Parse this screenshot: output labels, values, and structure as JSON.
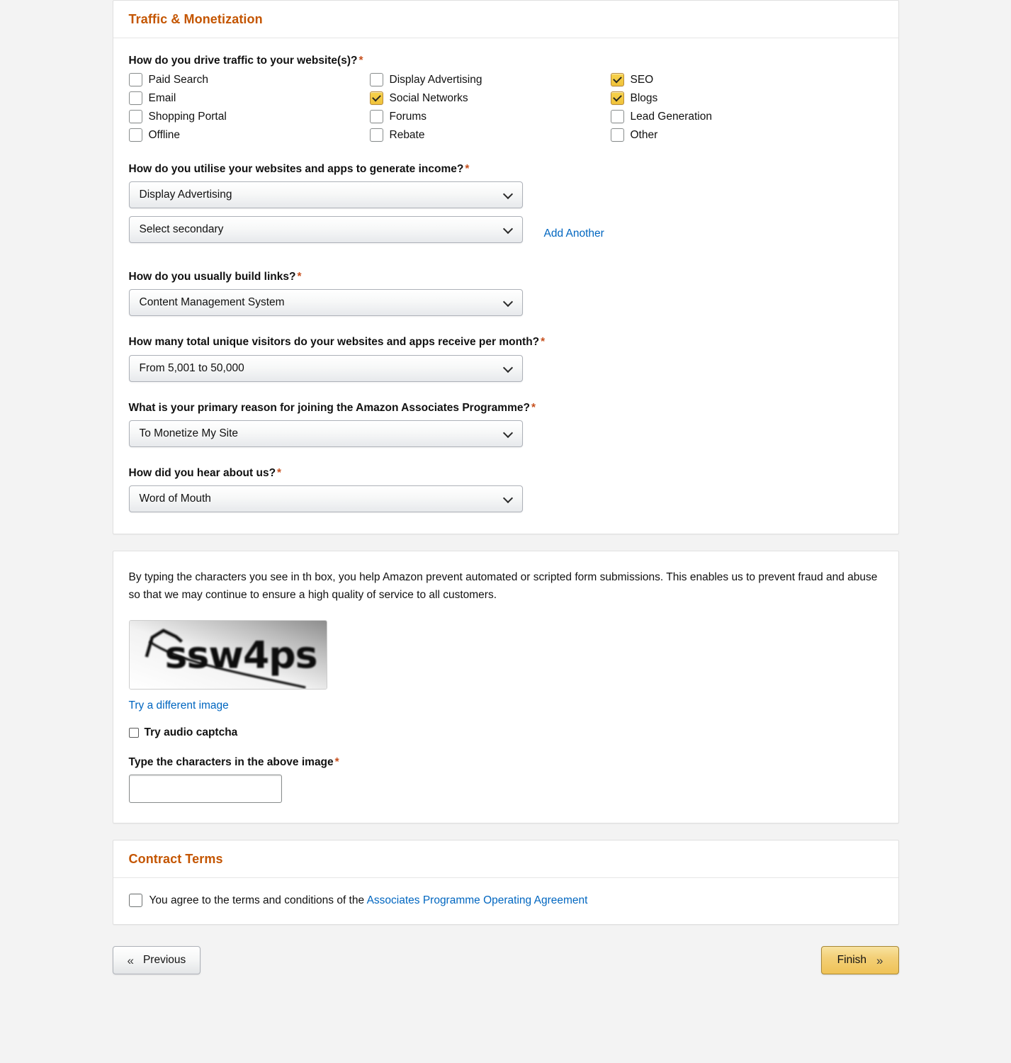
{
  "traffic_panel": {
    "title": "Traffic & Monetization",
    "traffic_question": {
      "label": "How do you drive traffic to your website(s)?",
      "required": "*",
      "options": [
        {
          "label": "Paid Search",
          "checked": false
        },
        {
          "label": "Email",
          "checked": false
        },
        {
          "label": "Shopping Portal",
          "checked": false
        },
        {
          "label": "Offline",
          "checked": false
        },
        {
          "label": "Display Advertising",
          "checked": false
        },
        {
          "label": "Social Networks",
          "checked": true
        },
        {
          "label": "Forums",
          "checked": false
        },
        {
          "label": "Rebate",
          "checked": false
        },
        {
          "label": "SEO",
          "checked": true
        },
        {
          "label": "Blogs",
          "checked": true
        },
        {
          "label": "Lead Generation",
          "checked": false
        },
        {
          "label": "Other",
          "checked": false
        }
      ]
    },
    "income_question": {
      "label": "How do you utilise your websites and apps to generate income?",
      "required": "*",
      "primary_value": "Display Advertising",
      "secondary_value": "Select secondary",
      "add_another_label": "Add Another"
    },
    "links_question": {
      "label": "How do you usually build links?",
      "required": "*",
      "value": "Content Management System"
    },
    "visitors_question": {
      "label": "How many total unique visitors do your websites and apps receive per month?",
      "required": "*",
      "value": "From 5,001 to 50,000"
    },
    "reason_question": {
      "label": "What is your primary reason for joining the Amazon Associates Programme?",
      "required": "*",
      "value": "To Monetize My Site"
    },
    "hear_question": {
      "label": "How did you hear about us?",
      "required": "*",
      "value": "Word of Mouth"
    }
  },
  "captcha_panel": {
    "intro_text": "By typing the characters you see in th box, you help Amazon prevent automated or scripted form submissions. This enables us to prevent fraud and abuse so that we may continue to ensure a high quality of service to all customers.",
    "captcha_characters": "ssw4ps",
    "try_different_image_label": "Try a different image",
    "audio_captcha_label": "Try audio captcha",
    "audio_captcha_checked": false,
    "type_characters_label": "Type the characters in the above image",
    "type_characters_required": "*",
    "captcha_input_value": "",
    "captcha_input_placeholder": ""
  },
  "contract_panel": {
    "title": "Contract Terms",
    "agree_prefix": "You agree to the terms and conditions of the ",
    "agreement_link_label": "Associates Programme Operating Agreement",
    "agree_checked": false
  },
  "footer": {
    "previous_label": "Previous",
    "previous_icon": "chevron-double-left-icon",
    "finish_label": "Finish",
    "finish_icon": "chevron-double-right-icon"
  },
  "colors": {
    "accent_orange": "#c45500",
    "link_blue": "#0066c0",
    "required_red": "#c7511f",
    "checkbox_gold": "#f0c33c",
    "finish_gold": "#efc256",
    "page_background": "#f3f3f3",
    "panel_background": "#ffffff"
  }
}
